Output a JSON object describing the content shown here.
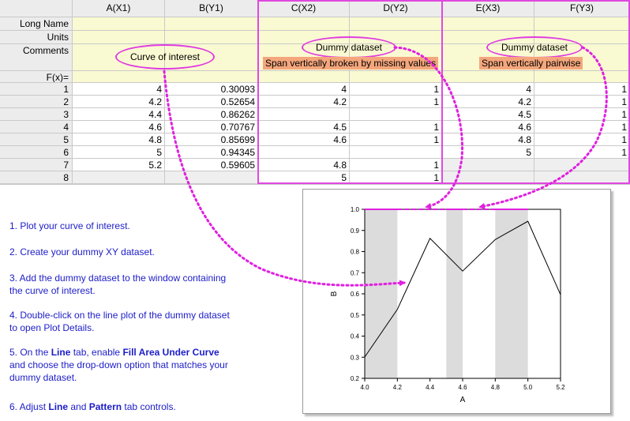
{
  "columns": [
    {
      "label": "A(X1)"
    },
    {
      "label": "B(Y1)"
    },
    {
      "label": "C(X2)"
    },
    {
      "label": "D(Y2)"
    },
    {
      "label": "E(X3)"
    },
    {
      "label": "F(Y3)"
    }
  ],
  "meta_rows": [
    "Long Name",
    "Units",
    "Comments",
    "F(x)="
  ],
  "row_numbers": [
    "1",
    "2",
    "3",
    "4",
    "5",
    "6",
    "7",
    "8"
  ],
  "rows": [
    [
      "4",
      "0.30093",
      "4",
      "1",
      "4",
      "1"
    ],
    [
      "4.2",
      "0.52654",
      "4.2",
      "1",
      "4.2",
      "1"
    ],
    [
      "4.4",
      "0.86262",
      "",
      "",
      "4.5",
      "1"
    ],
    [
      "4.6",
      "0.70767",
      "4.5",
      "1",
      "4.6",
      "1"
    ],
    [
      "4.8",
      "0.85699",
      "4.6",
      "1",
      "4.8",
      "1"
    ],
    [
      "5",
      "0.94345",
      "",
      "",
      "5",
      "1"
    ],
    [
      "5.2",
      "0.59605",
      "4.8",
      "1",
      "",
      ""
    ],
    [
      "",
      "",
      "5",
      "1",
      "",
      ""
    ]
  ],
  "annotations": {
    "curve_of_interest": "Curve of interest",
    "dummy_dataset_1": "Dummy dataset",
    "dummy_dataset_2": "Dummy dataset",
    "span_broken": "Span vertically broken by missing values",
    "span_pairwise": "Span vertically pairwise"
  },
  "instructions": {
    "step1": "1. Plot your curve of interest.",
    "step2": "2. Create your dummy XY dataset.",
    "step3_line1": "3. Add the dummy dataset to the window containing",
    "step3_line2": "the curve of interest.",
    "step4_line1": "4. Double-click on the line plot of the dummy dataset",
    "step4_line2": "to open Plot Details.",
    "step5_pre": "5. On the ",
    "step5_b1": "Line",
    "step5_mid": " tab, enable ",
    "step5_b2": "Fill Area Under Curve",
    "step5_line2": "and choose the drop-down option that matches your",
    "step5_line3": "dummy dataset.",
    "step6_pre": "6. Adjust ",
    "step6_b1": "Line",
    "step6_mid": " and ",
    "step6_b2": "Pattern",
    "step6_post": " tab controls."
  },
  "colors": {
    "accent": "#e020e0",
    "instruction_text": "#1c1cc8",
    "meta_row": "#fafad2",
    "highlight_label": "#f4a67c",
    "fill_band": "#dcdcdc"
  },
  "chart_data": {
    "type": "line",
    "xlabel": "A",
    "ylabel": "B",
    "xlim": [
      4.0,
      5.2
    ],
    "ylim": [
      0.2,
      1.0
    ],
    "x_ticks": [
      4.0,
      4.2,
      4.4,
      4.6,
      4.8,
      5.0,
      5.2
    ],
    "x_tick_labels": [
      "4.0",
      "4.2",
      "4.4",
      "4.6",
      "4.8",
      "5.0",
      "5.2"
    ],
    "y_ticks": [
      0.2,
      0.3,
      0.4,
      0.5,
      0.6,
      0.7,
      0.8,
      0.9,
      1.0
    ],
    "y_tick_labels": [
      "0.2",
      "0.3",
      "0.4",
      "0.5",
      "0.6",
      "0.7",
      "0.8",
      "0.9",
      "1.0"
    ],
    "series": [
      {
        "x": [
          4.0,
          4.2,
          4.4,
          4.6,
          4.8,
          5.0,
          5.2
        ],
        "y": [
          0.30093,
          0.52654,
          0.86262,
          0.70767,
          0.85699,
          0.94345,
          0.59605
        ],
        "color": "#000000"
      }
    ],
    "dummy_segments": [
      [
        4.0,
        4.2
      ],
      [
        4.5,
        4.6
      ],
      [
        4.8,
        5.0
      ]
    ],
    "dummy_y": 1.0,
    "dummy_color": "#e020e0",
    "fill_color": "#dcdcdc",
    "grid": false
  }
}
